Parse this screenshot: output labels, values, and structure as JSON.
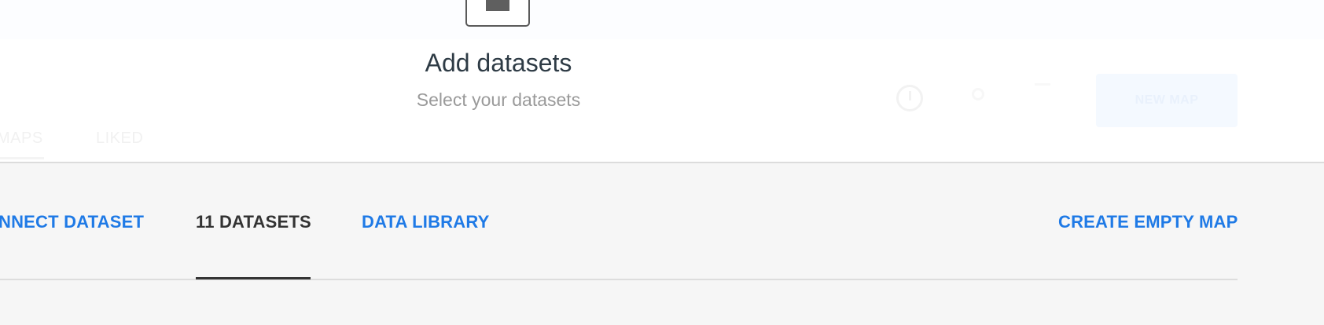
{
  "background": {
    "nav_items": [
      {
        "label": "MAPS"
      },
      {
        "label": "LIKED"
      }
    ],
    "new_map_button_label": "NEW MAP"
  },
  "modal": {
    "icon": "dataset-add-icon",
    "title": "Add datasets",
    "subtitle": "Select your datasets"
  },
  "tabs": {
    "connect_dataset": "NNECT DATASET",
    "datasets_count": "11 DATASETS",
    "data_library": "DATA LIBRARY",
    "create_empty_map": "CREATE EMPTY MAP",
    "active_tab": "11 DATASETS"
  },
  "colors": {
    "link": "#1f7ae6",
    "active_tab": "#333333",
    "panel_background": "#f6f6f6",
    "title": "#2e3b45",
    "subtitle": "#9a9a9a"
  }
}
